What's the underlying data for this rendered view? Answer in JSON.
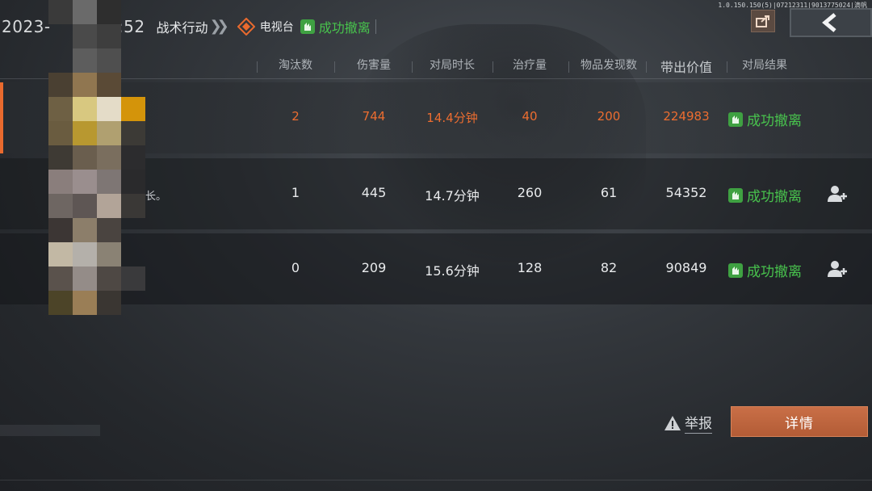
{
  "version_text": "1.0.150.150(5)|07212311|9013775024|滴帆",
  "header": {
    "date_prefix": "2023-",
    "time_suffix": "2:52",
    "mode": "战术行动",
    "chevron_icon": "double-chevron-right-icon",
    "station_icon": "tv-station-icon",
    "station": "电视台",
    "status_icon": "extract-success-icon",
    "status": "成功撤离"
  },
  "top_right": {
    "share_icon": "share-icon",
    "back_icon": "back-arrow-icon"
  },
  "columns": [
    "淘汰数",
    "伤害量",
    "对局时长",
    "治疗量",
    "物品发现数",
    "带出价值",
    "对局结果"
  ],
  "rows": [
    {
      "eliminations": "2",
      "damage": "744",
      "duration": "14.4分钟",
      "healing": "40",
      "items_found": "200",
      "extracted_value": "224983",
      "result": "成功撤离",
      "highlighted": true,
      "name_tail": "",
      "can_add_friend": false
    },
    {
      "eliminations": "1",
      "damage": "445",
      "duration": "14.7分钟",
      "healing": "260",
      "items_found": "61",
      "extracted_value": "54352",
      "result": "成功撤离",
      "highlighted": false,
      "name_tail": "长。",
      "can_add_friend": true
    },
    {
      "eliminations": "0",
      "damage": "209",
      "duration": "15.6分钟",
      "healing": "128",
      "items_found": "82",
      "extracted_value": "90849",
      "result": "成功撤离",
      "highlighted": false,
      "name_tail": "",
      "can_add_friend": true
    }
  ],
  "buttons": {
    "report": "举报",
    "report_icon": "warning-triangle-icon",
    "details": "详情"
  },
  "colors": {
    "accent_orange": "#ec6d30",
    "success_green": "#48c34d",
    "details_button": "#c96f47"
  }
}
